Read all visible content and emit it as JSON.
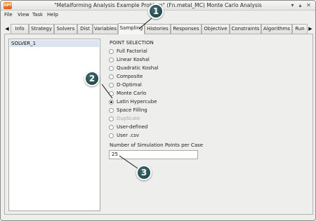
{
  "window": {
    "title": "\"Metalforming Analysis Example Problem\" (F",
    "title_suffix": "n.metal_MC)   Monte Carlo Analysis",
    "app_icon_text": "OPT"
  },
  "menu": [
    {
      "label": "File"
    },
    {
      "label": "View"
    },
    {
      "label": "Task"
    },
    {
      "label": "Help"
    }
  ],
  "tabs": [
    {
      "label": "Info"
    },
    {
      "label": "Strategy"
    },
    {
      "label": "Solvers"
    },
    {
      "label": "Dist"
    },
    {
      "label": "Variables"
    },
    {
      "label": "Sampling"
    },
    {
      "label": "Histories"
    },
    {
      "label": "Responses"
    },
    {
      "label": "Objective"
    },
    {
      "label": "Constraints"
    },
    {
      "label": "Algorithms"
    },
    {
      "label": "Run"
    }
  ],
  "active_tab": "Sampling",
  "solvers": [
    "SOLVER_1"
  ],
  "point_selection": {
    "title": "POINT SELECTION",
    "options": [
      {
        "label": "Full Factorial",
        "checked": false,
        "disabled": false
      },
      {
        "label": "Linear Koshal",
        "checked": false,
        "disabled": false
      },
      {
        "label": "Quadratic Koshal",
        "checked": false,
        "disabled": false
      },
      {
        "label": "Composite",
        "checked": false,
        "disabled": false
      },
      {
        "label": "D-Optimal",
        "checked": false,
        "disabled": false
      },
      {
        "label": "Monte Carlo",
        "checked": false,
        "disabled": false
      },
      {
        "label": "Latin Hypercube",
        "checked": true,
        "disabled": false
      },
      {
        "label": "Space Filling",
        "checked": false,
        "disabled": false
      },
      {
        "label": "Duplicate",
        "checked": false,
        "disabled": true
      },
      {
        "label": "User-defined",
        "checked": false,
        "disabled": false
      },
      {
        "label": "User .csv",
        "checked": false,
        "disabled": false
      }
    ]
  },
  "simulation_points": {
    "label": "Number of Simulation Points per Case",
    "value": "25"
  },
  "callouts": [
    {
      "label": "1"
    },
    {
      "label": "2"
    },
    {
      "label": "3"
    }
  ],
  "colors": {
    "callout": "#234a4d",
    "selection": "#dbe4ef"
  }
}
